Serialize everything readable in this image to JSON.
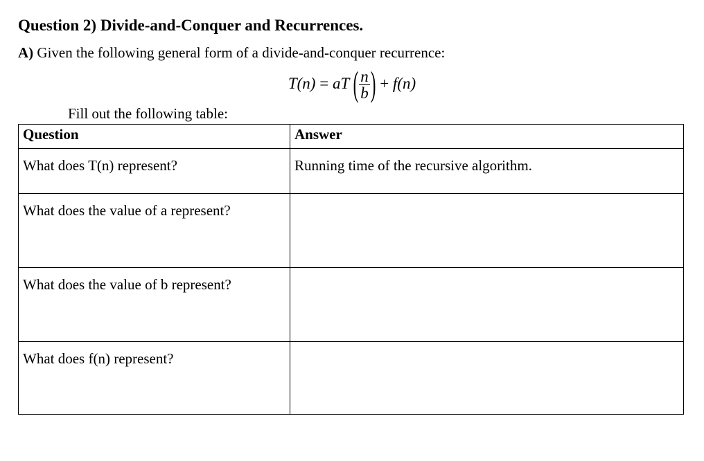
{
  "title": "Question 2) Divide-and-Conquer and Recurrences.",
  "partA": {
    "label": "A)",
    "text": " Given the following general form of a divide-and-conquer recurrence:"
  },
  "equation": {
    "lhs": "T(n)",
    "eq": " = ",
    "a": "aT ",
    "lparen": "(",
    "num": "n",
    "den": "b",
    "rparen": ")",
    "plus": " + ",
    "f": "f(n)"
  },
  "fillText": "Fill out the following table:",
  "table": {
    "headQuestion": "Question",
    "headAnswer": "Answer",
    "rows": [
      {
        "q": "What does T(n) represent?",
        "a": "Running time of the recursive algorithm."
      },
      {
        "q": "What does the value of a represent?",
        "a": ""
      },
      {
        "q": "What does the value of b represent?",
        "a": ""
      },
      {
        "q": "What does f(n) represent?",
        "a": ""
      }
    ]
  }
}
